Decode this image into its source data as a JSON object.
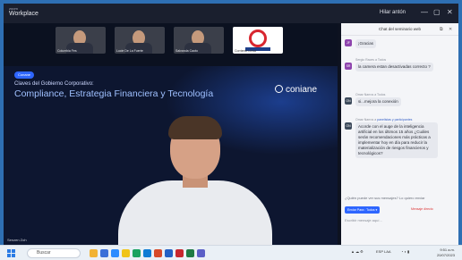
{
  "titlebar": {
    "app_small": "zoom",
    "app_name": "Workplace",
    "leave_label": "Hilar antón",
    "win_min": "—",
    "win_max": "▢",
    "win_close": "✕"
  },
  "participants": [
    {
      "name": "Columbia Fes"
    },
    {
      "name": "Lucie De La Fuerte"
    },
    {
      "name": "Salvarola Caoto"
    },
    {
      "name": "Corriente Lmsa"
    }
  ],
  "slide": {
    "badge": "Conane",
    "line1": "Claves del Gobierno Corporativo:",
    "line2": "Compliance, Estrategia Financiera y Tecnología",
    "brand": "coniane"
  },
  "self_view": {
    "name": "Senzen Zoh"
  },
  "chat": {
    "title": "Chat del seminario web",
    "messages": [
      {
        "meta": "",
        "initials": "JF",
        "color": "#8e44ad",
        "text": "¡Gracias"
      },
      {
        "meta": "Sergio Races a Todos",
        "initials": "SR",
        "color": "#8e44ad",
        "text": "la camera estan desactivadas correcto ?"
      },
      {
        "meta": "Omar Narros a Todos",
        "initials": "ON",
        "color": "#3d4b5c",
        "text": "si...mejora la conexión"
      },
      {
        "meta_a": "Omar Narros a ",
        "meta_b": "panelistas y participantes",
        "initials": "ON",
        "color": "#3d4b5c",
        "text": "Acorde con el auge de la inteligencia artificial en los últimos 15 años ¿Cuáles serán recomendaciones más prácticas a implementar hoy en día para reducir la materialización de riesgos financieros y tecnológicos?"
      }
    ],
    "composer_hint": "¿Quién puede ver sus mensajes? Lo quiero enviar",
    "to_label": "Enviar Para : Todos ▾",
    "more_label": "Mensaje directo",
    "input_placeholder": "Escribir mensaje aquí..."
  },
  "taskbar": {
    "search_placeholder": "Buscar",
    "tray_lang": "ESP LAA",
    "clock_time": "9:51 a.m.",
    "clock_date": "20/07/2023"
  }
}
